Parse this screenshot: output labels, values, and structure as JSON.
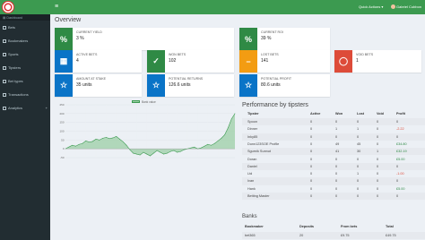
{
  "header": {
    "quick_actions": "Quick Actions ▾",
    "user_name": "Gabriel Cubbon"
  },
  "sidebar": {
    "heading": "Dashboard",
    "items": [
      {
        "label": "Bets"
      },
      {
        "label": "Bookmakers"
      },
      {
        "label": "Sports"
      },
      {
        "label": "Tipsters"
      },
      {
        "label": "Bet types"
      },
      {
        "label": "Transactions"
      },
      {
        "label": "Analytics"
      }
    ]
  },
  "overview": {
    "title": "Overview",
    "boxes": [
      {
        "label": "CURRENT YIELD",
        "value": "3 %",
        "icon": "percent-icon",
        "color": "#2f8a45"
      },
      {
        "label": "CURRENT ROI",
        "value": "39 %",
        "icon": "percent-icon",
        "color": "#2f8a45"
      },
      {
        "label": "ACTIVE BETS",
        "value": "4",
        "icon": "calendar-icon",
        "color": "#0a74c7"
      },
      {
        "label": "WON BETS",
        "value": "102",
        "icon": "check-icon",
        "color": "#2f8a45"
      },
      {
        "label": "LOST BETS",
        "value": "141",
        "icon": "minus-icon",
        "color": "#f39c12"
      },
      {
        "label": "VOID BETS",
        "value": "1",
        "icon": "circle-icon",
        "color": "#dd4b39"
      },
      {
        "label": "AMOUNT AT STAKE",
        "value": "35 units",
        "icon": "star-icon",
        "color": "#0a74c7"
      },
      {
        "label": "POTENTIAL RETURNS",
        "value": "126.6 units",
        "icon": "star-icon",
        "color": "#0a74c7"
      },
      {
        "label": "POTENTIAL PROFIT",
        "value": "80.6 units",
        "icon": "star-icon",
        "color": "#0a74c7"
      }
    ]
  },
  "chart_legend": "Bank value",
  "chart_data": {
    "type": "area",
    "title": "",
    "xlabel": "",
    "ylabel": "",
    "ylim": [
      -50,
      250
    ],
    "yticks": [
      250,
      200,
      150,
      100,
      50,
      0,
      -50
    ],
    "grid": true,
    "series": [
      {
        "name": "Bank value",
        "values": [
          0,
          10,
          20,
          15,
          25,
          30,
          45,
          38,
          42,
          55,
          50,
          60,
          65,
          58,
          62,
          70,
          55,
          40,
          20,
          -5,
          -25,
          -30,
          -35,
          -20,
          -30,
          -40,
          -25,
          -10,
          -20,
          -30,
          -25,
          -15,
          -10,
          -20,
          -15,
          -5,
          0,
          5,
          10,
          0,
          5,
          15,
          25,
          20,
          30,
          45,
          60,
          80,
          120,
          170,
          200
        ]
      }
    ],
    "color": "#3c9a50"
  },
  "performance": {
    "title": "Performance by tipsters",
    "headers": [
      "Tipster",
      "Active",
      "Won",
      "Lost",
      "Void",
      "Profit"
    ],
    "rows": [
      {
        "name": "Spoon",
        "active": "0",
        "won": "0",
        "lost": "0",
        "void": "0",
        "profit": "0",
        "sign": ""
      },
      {
        "name": "Dinner",
        "active": "0",
        "won": "1",
        "lost": "1",
        "void": "0",
        "profit": "-2.22",
        "sign": "neg"
      },
      {
        "name": "Inky85",
        "active": "0",
        "won": "0",
        "lost": "0",
        "void": "0",
        "profit": "0",
        "sign": ""
      },
      {
        "name": "Dunn123SOE Profile",
        "active": "0",
        "won": "49",
        "lost": "45",
        "void": "0",
        "profit": "£34.80",
        "sign": "pos"
      },
      {
        "name": "Sgurnik Sunnut",
        "active": "0",
        "won": "41",
        "lost": "30",
        "void": "1",
        "profit": "£32.19",
        "sign": "pos"
      },
      {
        "name": "Doran",
        "active": "0",
        "won": "0",
        "lost": "0",
        "void": "0",
        "profit": "£5.00",
        "sign": "pos"
      },
      {
        "name": "Daniel",
        "active": "0",
        "won": "0",
        "lost": "0",
        "void": "0",
        "profit": "0",
        "sign": ""
      },
      {
        "name": "Ltd",
        "active": "0",
        "won": "0",
        "lost": "1",
        "void": "0",
        "profit": "-1.00",
        "sign": "neg"
      },
      {
        "name": "Ivan",
        "active": "0",
        "won": "0",
        "lost": "0",
        "void": "0",
        "profit": "0",
        "sign": ""
      },
      {
        "name": "Hank",
        "active": "0",
        "won": "0",
        "lost": "0",
        "void": "0",
        "profit": "£5.00",
        "sign": "pos"
      },
      {
        "name": "Betting Master",
        "active": "0",
        "won": "0",
        "lost": "0",
        "void": "0",
        "profit": "0",
        "sign": ""
      }
    ]
  },
  "banks": {
    "title": "Banks",
    "headers": [
      "Bookmaker",
      "Deposits",
      "From bets",
      "Total"
    ],
    "rows": [
      {
        "name": "bet365",
        "deposits": "20",
        "from_bets": "£9.75",
        "total": "£49.75"
      }
    ]
  }
}
